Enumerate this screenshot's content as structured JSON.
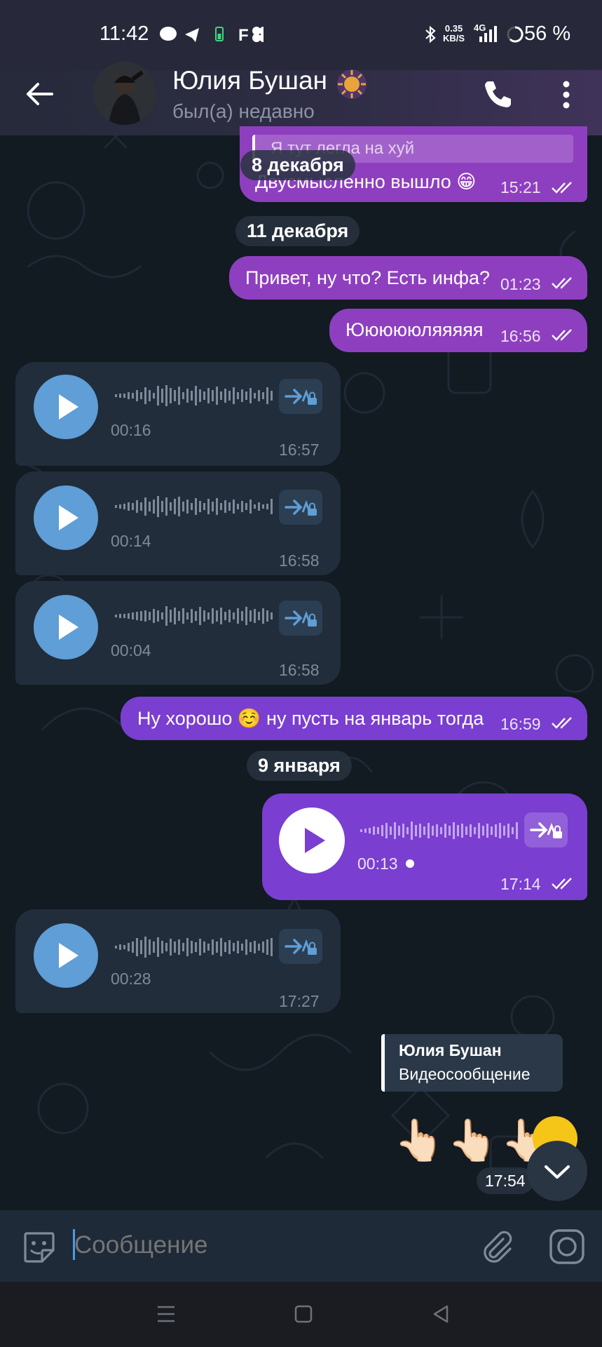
{
  "status_bar": {
    "time": "11:42",
    "network_speed_value": "0.35",
    "network_speed_unit": "KB/S",
    "network_type": "4G",
    "battery": "56 %"
  },
  "header": {
    "name": "Юлия Бушан",
    "last_seen": "был(а) недавно"
  },
  "messages": {
    "m1": {
      "quote": "Я тут легла на хуй",
      "text": "Двусмысленно вышло 😁",
      "time": "15:21"
    },
    "date1": "8 декабря",
    "date2": "11 декабря",
    "m2": {
      "text": "Привет, ну что? Есть инфа?",
      "time": "01:23"
    },
    "m3": {
      "text": "Юююююляяяяя",
      "time": "16:56"
    },
    "v1": {
      "duration": "00:16",
      "time": "16:57"
    },
    "v2": {
      "duration": "00:14",
      "time": "16:58"
    },
    "v3": {
      "duration": "00:04",
      "time": "16:58"
    },
    "m4": {
      "text": "Ну хорошо ☺️ ну пусть на январь тогда",
      "time": "16:59"
    },
    "date3": "9 января",
    "v4": {
      "duration": "00:13",
      "time": "17:14"
    },
    "v5": {
      "duration": "00:28",
      "time": "17:27"
    },
    "reply": {
      "name": "Юлия Бушан",
      "text": "Видеосообщение"
    },
    "m5": {
      "emoji": "👆🏻👆🏻👆🏻",
      "time": "17:54"
    }
  },
  "input": {
    "placeholder": "Сообщение"
  },
  "colors": {
    "outgoing_bubble": "#8e3fbf",
    "outgoing_bubble_voice": "#7a3ed1",
    "incoming_bubble": "#212d3b",
    "play_button": "#5f9ed6",
    "background": "#121a22"
  }
}
